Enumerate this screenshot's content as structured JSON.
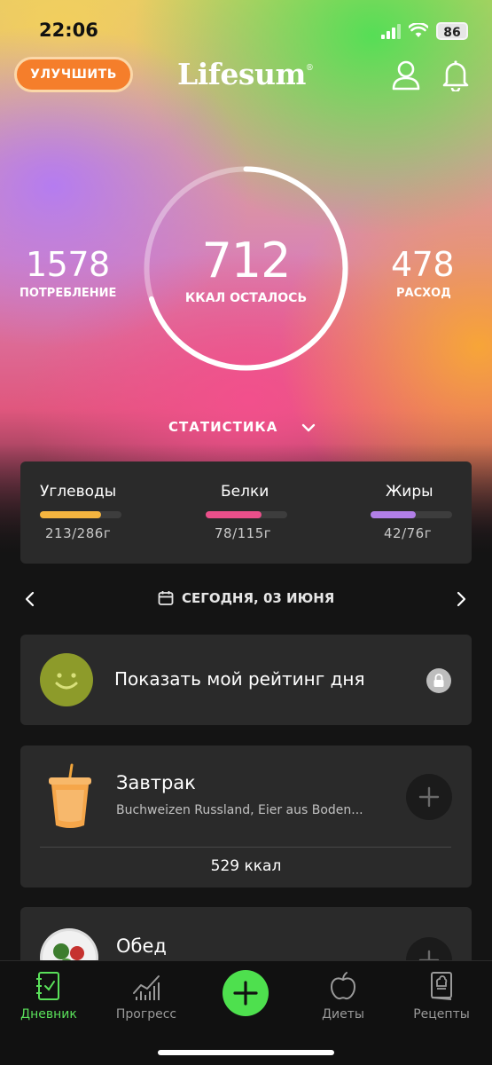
{
  "status_bar": {
    "time": "22:06",
    "battery": "86"
  },
  "header": {
    "upgrade_label": "УЛУЧШИТЬ",
    "logo": "Lifesum",
    "logo_mark": "®"
  },
  "summary": {
    "eaten_value": "1578",
    "eaten_label": "ПОТРЕБЛЕНИЕ",
    "remaining_value": "712",
    "remaining_label": "ККАЛ ОСТАЛОСЬ",
    "burned_value": "478",
    "burned_label": "РАСХОД",
    "ring_progress": 0.7
  },
  "stats_toggle": "СТАТИСТИКА",
  "macros": [
    {
      "name": "Углеводы",
      "value": "213/286г",
      "progress": 0.75,
      "color": "#f5b53f"
    },
    {
      "name": "Белки",
      "value": "78/115г",
      "progress": 0.68,
      "color": "#ea4f8a"
    },
    {
      "name": "Жиры",
      "value": "42/76г",
      "progress": 0.55,
      "color": "#b27fe8"
    }
  ],
  "date_nav": {
    "label": "СЕГОДНЯ, 03 ИЮНЯ"
  },
  "rating": {
    "title": "Показать мой рейтинг дня"
  },
  "breakfast": {
    "title": "Завтрак",
    "items": "Buchweizen Russland, Eier aus Boden...",
    "kcal": "529 ккал"
  },
  "lunch": {
    "title": "Обед"
  },
  "tabs": [
    {
      "label": "Дневник",
      "icon": "diary-icon",
      "active": true
    },
    {
      "label": "Прогресс",
      "icon": "progress-chart-icon",
      "active": false
    },
    {
      "label": "Диеты",
      "icon": "apple-icon",
      "active": false
    },
    {
      "label": "Рецепты",
      "icon": "recipe-book-icon",
      "active": false
    }
  ],
  "colors": {
    "accent_green": "#4ee04e",
    "upgrade_orange": "#f57e2b",
    "card_bg": "#2a2a2a"
  }
}
